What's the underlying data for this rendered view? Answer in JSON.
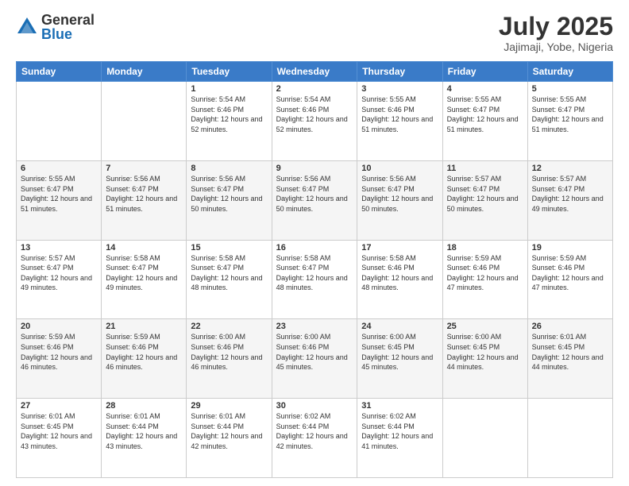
{
  "logo": {
    "general": "General",
    "blue": "Blue"
  },
  "header": {
    "month_year": "July 2025",
    "location": "Jajimaji, Yobe, Nigeria"
  },
  "days_of_week": [
    "Sunday",
    "Monday",
    "Tuesday",
    "Wednesday",
    "Thursday",
    "Friday",
    "Saturday"
  ],
  "weeks": [
    [
      {
        "day": "",
        "sunrise": "",
        "sunset": "",
        "daylight": ""
      },
      {
        "day": "",
        "sunrise": "",
        "sunset": "",
        "daylight": ""
      },
      {
        "day": "1",
        "sunrise": "Sunrise: 5:54 AM",
        "sunset": "Sunset: 6:46 PM",
        "daylight": "Daylight: 12 hours and 52 minutes."
      },
      {
        "day": "2",
        "sunrise": "Sunrise: 5:54 AM",
        "sunset": "Sunset: 6:46 PM",
        "daylight": "Daylight: 12 hours and 52 minutes."
      },
      {
        "day": "3",
        "sunrise": "Sunrise: 5:55 AM",
        "sunset": "Sunset: 6:46 PM",
        "daylight": "Daylight: 12 hours and 51 minutes."
      },
      {
        "day": "4",
        "sunrise": "Sunrise: 5:55 AM",
        "sunset": "Sunset: 6:47 PM",
        "daylight": "Daylight: 12 hours and 51 minutes."
      },
      {
        "day": "5",
        "sunrise": "Sunrise: 5:55 AM",
        "sunset": "Sunset: 6:47 PM",
        "daylight": "Daylight: 12 hours and 51 minutes."
      }
    ],
    [
      {
        "day": "6",
        "sunrise": "Sunrise: 5:55 AM",
        "sunset": "Sunset: 6:47 PM",
        "daylight": "Daylight: 12 hours and 51 minutes."
      },
      {
        "day": "7",
        "sunrise": "Sunrise: 5:56 AM",
        "sunset": "Sunset: 6:47 PM",
        "daylight": "Daylight: 12 hours and 51 minutes."
      },
      {
        "day": "8",
        "sunrise": "Sunrise: 5:56 AM",
        "sunset": "Sunset: 6:47 PM",
        "daylight": "Daylight: 12 hours and 50 minutes."
      },
      {
        "day": "9",
        "sunrise": "Sunrise: 5:56 AM",
        "sunset": "Sunset: 6:47 PM",
        "daylight": "Daylight: 12 hours and 50 minutes."
      },
      {
        "day": "10",
        "sunrise": "Sunrise: 5:56 AM",
        "sunset": "Sunset: 6:47 PM",
        "daylight": "Daylight: 12 hours and 50 minutes."
      },
      {
        "day": "11",
        "sunrise": "Sunrise: 5:57 AM",
        "sunset": "Sunset: 6:47 PM",
        "daylight": "Daylight: 12 hours and 50 minutes."
      },
      {
        "day": "12",
        "sunrise": "Sunrise: 5:57 AM",
        "sunset": "Sunset: 6:47 PM",
        "daylight": "Daylight: 12 hours and 49 minutes."
      }
    ],
    [
      {
        "day": "13",
        "sunrise": "Sunrise: 5:57 AM",
        "sunset": "Sunset: 6:47 PM",
        "daylight": "Daylight: 12 hours and 49 minutes."
      },
      {
        "day": "14",
        "sunrise": "Sunrise: 5:58 AM",
        "sunset": "Sunset: 6:47 PM",
        "daylight": "Daylight: 12 hours and 49 minutes."
      },
      {
        "day": "15",
        "sunrise": "Sunrise: 5:58 AM",
        "sunset": "Sunset: 6:47 PM",
        "daylight": "Daylight: 12 hours and 48 minutes."
      },
      {
        "day": "16",
        "sunrise": "Sunrise: 5:58 AM",
        "sunset": "Sunset: 6:47 PM",
        "daylight": "Daylight: 12 hours and 48 minutes."
      },
      {
        "day": "17",
        "sunrise": "Sunrise: 5:58 AM",
        "sunset": "Sunset: 6:46 PM",
        "daylight": "Daylight: 12 hours and 48 minutes."
      },
      {
        "day": "18",
        "sunrise": "Sunrise: 5:59 AM",
        "sunset": "Sunset: 6:46 PM",
        "daylight": "Daylight: 12 hours and 47 minutes."
      },
      {
        "day": "19",
        "sunrise": "Sunrise: 5:59 AM",
        "sunset": "Sunset: 6:46 PM",
        "daylight": "Daylight: 12 hours and 47 minutes."
      }
    ],
    [
      {
        "day": "20",
        "sunrise": "Sunrise: 5:59 AM",
        "sunset": "Sunset: 6:46 PM",
        "daylight": "Daylight: 12 hours and 46 minutes."
      },
      {
        "day": "21",
        "sunrise": "Sunrise: 5:59 AM",
        "sunset": "Sunset: 6:46 PM",
        "daylight": "Daylight: 12 hours and 46 minutes."
      },
      {
        "day": "22",
        "sunrise": "Sunrise: 6:00 AM",
        "sunset": "Sunset: 6:46 PM",
        "daylight": "Daylight: 12 hours and 46 minutes."
      },
      {
        "day": "23",
        "sunrise": "Sunrise: 6:00 AM",
        "sunset": "Sunset: 6:46 PM",
        "daylight": "Daylight: 12 hours and 45 minutes."
      },
      {
        "day": "24",
        "sunrise": "Sunrise: 6:00 AM",
        "sunset": "Sunset: 6:45 PM",
        "daylight": "Daylight: 12 hours and 45 minutes."
      },
      {
        "day": "25",
        "sunrise": "Sunrise: 6:00 AM",
        "sunset": "Sunset: 6:45 PM",
        "daylight": "Daylight: 12 hours and 44 minutes."
      },
      {
        "day": "26",
        "sunrise": "Sunrise: 6:01 AM",
        "sunset": "Sunset: 6:45 PM",
        "daylight": "Daylight: 12 hours and 44 minutes."
      }
    ],
    [
      {
        "day": "27",
        "sunrise": "Sunrise: 6:01 AM",
        "sunset": "Sunset: 6:45 PM",
        "daylight": "Daylight: 12 hours and 43 minutes."
      },
      {
        "day": "28",
        "sunrise": "Sunrise: 6:01 AM",
        "sunset": "Sunset: 6:44 PM",
        "daylight": "Daylight: 12 hours and 43 minutes."
      },
      {
        "day": "29",
        "sunrise": "Sunrise: 6:01 AM",
        "sunset": "Sunset: 6:44 PM",
        "daylight": "Daylight: 12 hours and 42 minutes."
      },
      {
        "day": "30",
        "sunrise": "Sunrise: 6:02 AM",
        "sunset": "Sunset: 6:44 PM",
        "daylight": "Daylight: 12 hours and 42 minutes."
      },
      {
        "day": "31",
        "sunrise": "Sunrise: 6:02 AM",
        "sunset": "Sunset: 6:44 PM",
        "daylight": "Daylight: 12 hours and 41 minutes."
      },
      {
        "day": "",
        "sunrise": "",
        "sunset": "",
        "daylight": ""
      },
      {
        "day": "",
        "sunrise": "",
        "sunset": "",
        "daylight": ""
      }
    ]
  ]
}
